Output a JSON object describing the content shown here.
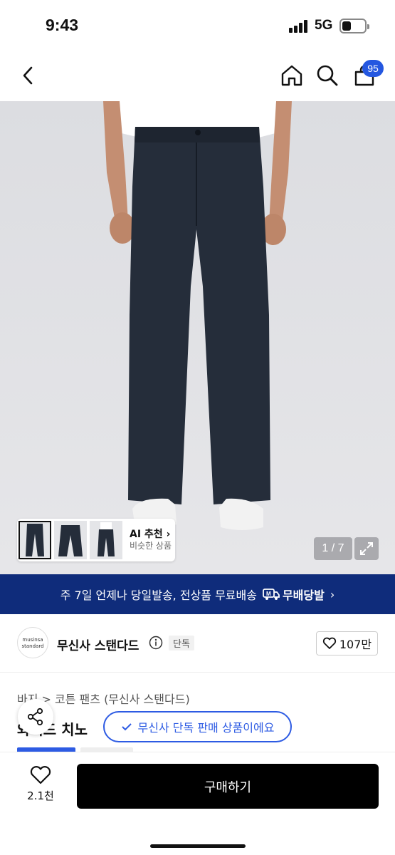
{
  "status_bar": {
    "time": "9:43",
    "network": "5G"
  },
  "nav": {
    "cart_count": "95"
  },
  "gallery": {
    "ai_title": "AI 추천",
    "ai_sub": "비슷한 상품",
    "counter": "1 / 7"
  },
  "shipping_banner": {
    "text": "주 7일 언제나 당일발송, 전상품 무료배송",
    "logo_text": "무배당발"
  },
  "brand": {
    "logo_line1": "musinsa",
    "logo_line2": "standard",
    "name": "무신사 스탠다드",
    "exclusive_badge": "단독",
    "like_count": "107만"
  },
  "product": {
    "breadcrumb": "바지 > 코튼 팬츠 (무신사 스탠다드)",
    "title": "와이드 치노",
    "exclusive_notice": "무신사 단독 판매 상품이에요"
  },
  "bottom_bar": {
    "wish_count": "2.1천",
    "buy_label": "구매하기"
  },
  "colors": {
    "accent_blue": "#2d5be3",
    "banner_navy": "#0f2c7b",
    "badge_blue": "#2457e0"
  }
}
